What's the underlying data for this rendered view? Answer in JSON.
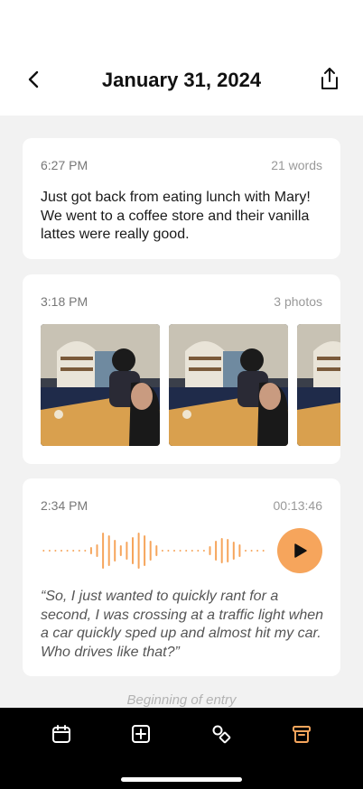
{
  "header": {
    "title": "January 31, 2024",
    "back_icon": "chevron-left-icon",
    "share_icon": "share-icon"
  },
  "text_entry": {
    "time": "6:27 PM",
    "word_count": "21 words",
    "body": "Just got back from eating lunch with Mary! We went to a coffee store and their vanilla lattes were really good."
  },
  "photo_entry": {
    "time": "3:18 PM",
    "photo_count": "3 photos",
    "photos": [
      "photo-1",
      "photo-2",
      "photo-3"
    ]
  },
  "audio_entry": {
    "time": "2:34 PM",
    "duration": "00:13:46",
    "transcript": "“So, I just wanted to quickly rant for a second, I was crossing at a traffic light when a car quickly sped up and almost hit my car. Who drives like that?”",
    "play_icon": "play-icon"
  },
  "footer_note": "Beginning of entry",
  "tabbar": {
    "items": [
      {
        "icon": "calendar-icon",
        "active": false
      },
      {
        "icon": "add-entry-icon",
        "active": false
      },
      {
        "icon": "shapes-icon",
        "active": false
      },
      {
        "icon": "archive-icon",
        "active": true
      }
    ]
  },
  "colors": {
    "accent": "#f6a55c",
    "background": "#f2f2f2",
    "card": "#ffffff",
    "tabbar": "#000000"
  }
}
